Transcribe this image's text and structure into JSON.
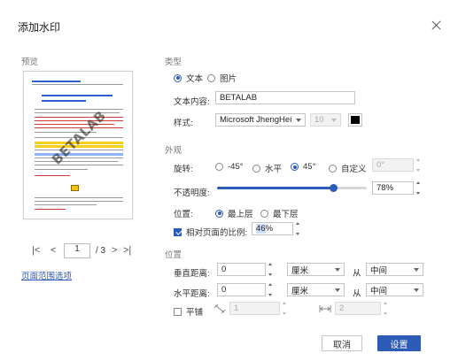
{
  "dialog": {
    "title": "添加水印"
  },
  "preview": {
    "section_label": "预览",
    "watermark_text": "BETALAB",
    "pager": {
      "first": "|<",
      "prev": "<",
      "current": "1",
      "total": "/ 3",
      "next": ">",
      "last": ">|"
    },
    "page_range_link": "页面范围选项"
  },
  "type_section": {
    "label": "类型",
    "options": [
      {
        "label": "文本",
        "selected": true
      },
      {
        "label": "图片",
        "selected": false
      }
    ],
    "text_content_label": "文本内容:",
    "text_content_value": "BETALAB",
    "style_label": "样式:",
    "font_value": "Microsoft JhengHei",
    "size_value": "10",
    "color": "#000000"
  },
  "appearance_section": {
    "label": "外观",
    "rotation_label": "旋转:",
    "rotation_options": [
      {
        "label": "-45°",
        "selected": false
      },
      {
        "label": "水平",
        "selected": false
      },
      {
        "label": "45°",
        "selected": true
      },
      {
        "label": "自定义",
        "selected": false
      }
    ],
    "custom_angle_value": "0°",
    "opacity_label": "不透明度:",
    "opacity_value": "78%",
    "opacity_fraction": 0.78,
    "position_label": "位置:",
    "position_options": [
      {
        "label": "最上层",
        "selected": true
      },
      {
        "label": "最下层",
        "selected": false
      }
    ],
    "scale_label": "相对页面的比例:",
    "scale_checked": true,
    "scale_value_selected": "46",
    "scale_value_rest": "%"
  },
  "position_section": {
    "label": "位置",
    "vertical_label": "垂直距离:",
    "vertical_value": "0",
    "vertical_unit": "厘米",
    "vertical_from_label": "从",
    "vertical_from_value": "中间",
    "horizontal_label": "水平距离:",
    "horizontal_value": "0",
    "horizontal_unit": "厘米",
    "horizontal_from_label": "从",
    "horizontal_from_value": "中间",
    "tile_label": "平铺",
    "tile_checked": false,
    "tile_row_value": "1",
    "tile_col_value": "2"
  },
  "buttons": {
    "cancel": "取消",
    "ok": "设置"
  },
  "colors": {
    "accent": "#2c5bb8"
  }
}
